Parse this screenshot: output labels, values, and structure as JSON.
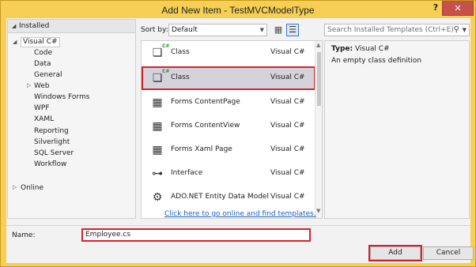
{
  "window": {
    "title": "Add New Item - TestMVCModelType",
    "help": "?",
    "close": "✕"
  },
  "tree": {
    "header": "Installed",
    "root": "Visual C#",
    "items": [
      "Code",
      "Data",
      "General",
      "Web",
      "Windows Forms",
      "WPF",
      "XAML",
      "Reporting",
      "Silverlight",
      "SQL Server",
      "Workflow"
    ],
    "online": "Online"
  },
  "sort": {
    "label": "Sort by:",
    "value": "Default"
  },
  "templates": [
    {
      "name": "Class",
      "lang": "Visual C#",
      "icon": "class-icon"
    },
    {
      "name": "Class",
      "lang": "Visual C#",
      "icon": "class-icon"
    },
    {
      "name": "Forms ContentPage",
      "lang": "Visual C#",
      "icon": "forms-page-icon"
    },
    {
      "name": "Forms ContentView",
      "lang": "Visual C#",
      "icon": "forms-view-icon"
    },
    {
      "name": "Forms Xaml Page",
      "lang": "Visual C#",
      "icon": "forms-xaml-icon"
    },
    {
      "name": "Interface",
      "lang": "Visual C#",
      "icon": "interface-icon"
    },
    {
      "name": "ADO.NET Entity Data Model",
      "lang": "Visual C#",
      "icon": "entity-model-icon"
    }
  ],
  "search": {
    "placeholder": "Search Installed Templates (Ctrl+E)"
  },
  "details": {
    "type_label": "Type:",
    "type_value": "Visual C#",
    "description": "An empty class definition"
  },
  "online_link": "Click here to go online and find templates.",
  "name_field": {
    "label": "Name:",
    "value": "Employee.cs"
  },
  "buttons": {
    "add": "Add",
    "cancel": "Cancel"
  },
  "colors": {
    "title_bar": "#f7cf55",
    "close_button": "#c7504a",
    "highlight_outline": "#d2232a",
    "link": "#1b5fbf"
  }
}
